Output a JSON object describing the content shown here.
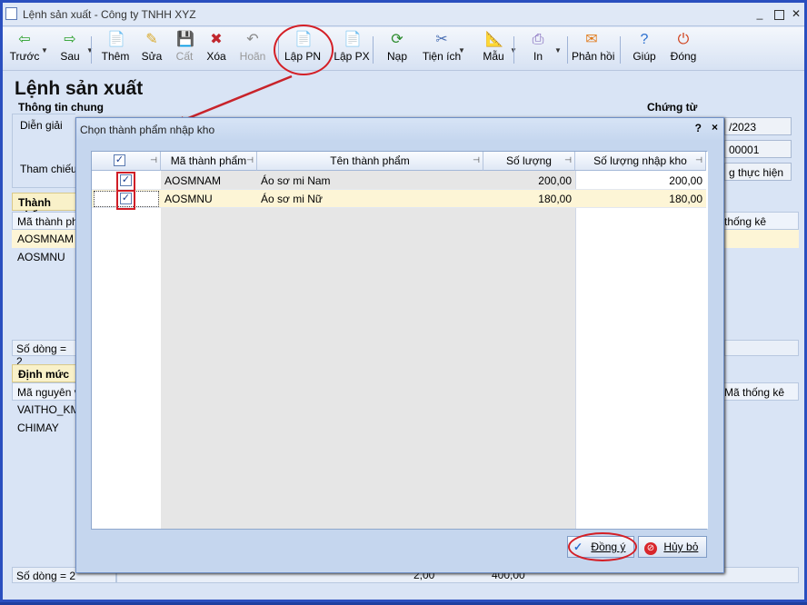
{
  "window": {
    "title": "Lệnh sản xuất - Công ty TNHH XYZ",
    "minimize": "_",
    "maximize": "□",
    "close": "✕"
  },
  "toolbar": {
    "items": [
      {
        "label": "Trước",
        "icon": "arrow-left-icon",
        "glyph": "⇦",
        "color": "#2aa02a"
      },
      {
        "label": "Sau",
        "icon": "arrow-right-icon",
        "glyph": "⇨",
        "color": "#2aa02a"
      },
      {
        "label": "Thêm",
        "icon": "add-doc-icon",
        "glyph": "📄",
        "color": "#d9a92b"
      },
      {
        "label": "Sửa",
        "icon": "edit-doc-icon",
        "glyph": "✎",
        "color": "#d9a92b"
      },
      {
        "label": "Cất",
        "icon": "save-icon",
        "glyph": "💾",
        "color": "#888"
      },
      {
        "label": "Xóa",
        "icon": "delete-doc-icon",
        "glyph": "✖",
        "color": "#c0262d"
      },
      {
        "label": "Hoãn",
        "icon": "undo-icon",
        "glyph": "↶",
        "color": "#888"
      },
      {
        "label": "Lập PN",
        "icon": "create-receipt-icon",
        "glyph": "📄",
        "color": "#d9a92b"
      },
      {
        "label": "Lập PX",
        "icon": "create-issue-icon",
        "glyph": "📄",
        "color": "#d9a92b"
      },
      {
        "label": "Nạp",
        "icon": "refresh-icon",
        "glyph": "⟳",
        "color": "#2a8a2a"
      },
      {
        "label": "Tiện ích",
        "icon": "tools-icon",
        "glyph": "✂",
        "color": "#4a6fb3"
      },
      {
        "label": "Mẫu",
        "icon": "template-icon",
        "glyph": "📐",
        "color": "#c8862b"
      },
      {
        "label": "In",
        "icon": "print-icon",
        "glyph": "⎙",
        "color": "#7a5fb8"
      },
      {
        "label": "Phản hồi",
        "icon": "feedback-icon",
        "glyph": "✉",
        "color": "#e07a1a"
      },
      {
        "label": "Giúp",
        "icon": "help-icon",
        "glyph": "?",
        "color": "#2a6fcf"
      },
      {
        "label": "Đóng",
        "icon": "close-power-icon",
        "glyph": "⏻",
        "color": "#d0401a"
      }
    ]
  },
  "page": {
    "title": "Lệnh sản xuất",
    "general_group": "Thông tin chung",
    "voucher_group": "Chứng từ",
    "label_description": "Diễn giải",
    "label_reference": "Tham chiếu",
    "date_partial": "/2023",
    "number_partial": "00001",
    "status_partial": "g thực hiện",
    "section_products": "Thành phẩ",
    "section_norms": "Định mức x",
    "products_col1": "Mã thành phẩ",
    "products_col_stat": "thống kê",
    "products_rows": [
      "AOSMNAM",
      "AOSMNU"
    ],
    "products_footer": "Số dòng = 2",
    "norms_col1": "Mã nguyên vậ",
    "norms_col_stat": "Mã thống kê",
    "norms_rows": [
      "VAITHO_KM",
      "CHIMAY"
    ],
    "norms_footer": "Số dòng = 2",
    "norms_footer_v1": "2,00",
    "norms_footer_v2": "400,00"
  },
  "dialog": {
    "title": "Chọn thành phẩm nhập kho",
    "help": "?",
    "close": "×",
    "columns": [
      "Mã thành phẩm",
      "Tên thành phẩm",
      "Số lượng",
      "Số lượng nhập kho"
    ],
    "rows": [
      {
        "checked": true,
        "code": "AOSMNAM",
        "name": "Áo sơ mi Nam",
        "qty": "200,00",
        "qty_in": "200,00"
      },
      {
        "checked": true,
        "code": "AOSMNU",
        "name": "Áo sơ mi Nữ",
        "qty": "180,00",
        "qty_in": "180,00"
      }
    ],
    "ok_label": "Đồng ý",
    "cancel_label": "Hủy bỏ"
  },
  "colors": {
    "accent": "#2a4fbf",
    "highlight": "#d01d26",
    "selected_row": "#fdf5d6"
  }
}
